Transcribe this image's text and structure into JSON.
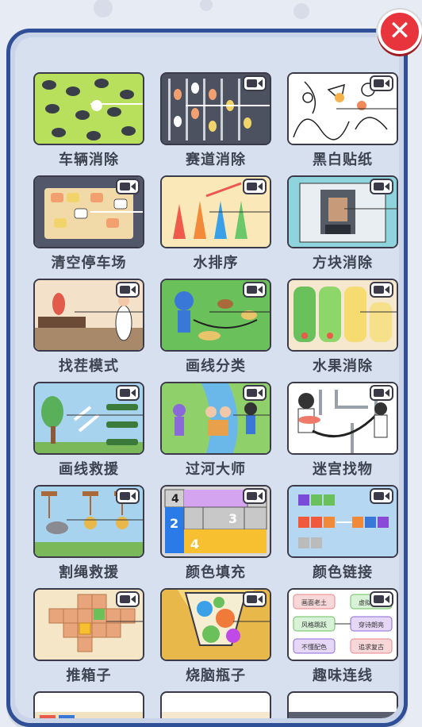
{
  "close": {
    "label": "✕"
  },
  "games": [
    {
      "label": "车辆消除",
      "icon": "car-elimination-thumb"
    },
    {
      "label": "赛道消除",
      "icon": "track-elimination-thumb"
    },
    {
      "label": "黑白贴纸",
      "icon": "bw-sticker-thumb"
    },
    {
      "label": "清空停车场",
      "icon": "parking-lot-thumb"
    },
    {
      "label": "水排序",
      "icon": "water-sort-thumb"
    },
    {
      "label": "方块消除",
      "icon": "block-elimination-thumb"
    },
    {
      "label": "找茬模式",
      "icon": "spot-difference-thumb"
    },
    {
      "label": "画线分类",
      "icon": "draw-line-sort-thumb"
    },
    {
      "label": "水果消除",
      "icon": "fruit-elimination-thumb"
    },
    {
      "label": "画线救援",
      "icon": "draw-line-rescue-thumb"
    },
    {
      "label": "过河大师",
      "icon": "river-crossing-thumb"
    },
    {
      "label": "迷宫找物",
      "icon": "maze-find-thumb"
    },
    {
      "label": "割绳救援",
      "icon": "cut-rope-thumb"
    },
    {
      "label": "颜色填充",
      "icon": "color-fill-thumb"
    },
    {
      "label": "颜色链接",
      "icon": "color-link-thumb"
    },
    {
      "label": "推箱子",
      "icon": "push-box-thumb"
    },
    {
      "label": "烧脑瓶子",
      "icon": "brain-bottle-thumb"
    },
    {
      "label": "趣味连线",
      "icon": "fun-connect-thumb"
    }
  ],
  "thumb_text": {
    "fill_numbers": [
      "4",
      "2",
      "3",
      "2",
      "4"
    ],
    "connect_words": [
      "画面老土",
      "虚拟世界",
      "风格跳跃",
      "穿诗朗亮",
      "不懂配色",
      "追求复古"
    ]
  },
  "colors": {
    "close_bg": "#e8343c",
    "panel_border": "#2f4f96",
    "card_border": "#3a3a48"
  }
}
